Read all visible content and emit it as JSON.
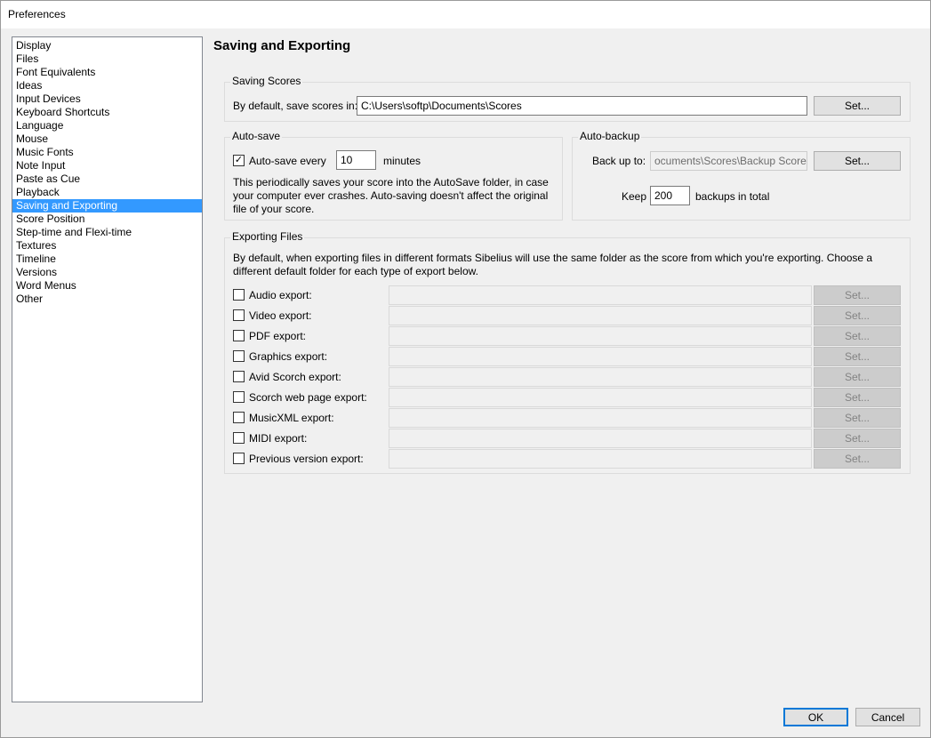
{
  "window": {
    "title": "Preferences"
  },
  "sidebar": {
    "items": [
      {
        "label": "Display"
      },
      {
        "label": "Files"
      },
      {
        "label": "Font Equivalents"
      },
      {
        "label": "Ideas"
      },
      {
        "label": "Input Devices"
      },
      {
        "label": "Keyboard Shortcuts"
      },
      {
        "label": "Language"
      },
      {
        "label": "Mouse"
      },
      {
        "label": "Music Fonts"
      },
      {
        "label": "Note Input"
      },
      {
        "label": "Paste as Cue"
      },
      {
        "label": "Playback"
      },
      {
        "label": "Saving and Exporting"
      },
      {
        "label": "Score Position"
      },
      {
        "label": "Step-time and Flexi-time"
      },
      {
        "label": "Textures"
      },
      {
        "label": "Timeline"
      },
      {
        "label": "Versions"
      },
      {
        "label": "Word Menus"
      },
      {
        "label": "Other"
      }
    ],
    "selected": "Saving and Exporting"
  },
  "page": {
    "title": "Saving and Exporting"
  },
  "saving_scores": {
    "group_label": "Saving Scores",
    "label": "By default, save scores in:",
    "path": "C:\\Users\\softp\\Documents\\Scores",
    "set_label": "Set..."
  },
  "auto_save": {
    "group_label": "Auto-save",
    "checkbox_label": "Auto-save every",
    "checked": true,
    "minutes_value": "10",
    "minutes_label": "minutes",
    "description_lines": [
      "This periodically saves your score into the AutoSave folder, in case",
      "your computer ever crashes. Auto-saving doesn't affect the original",
      "file of your score."
    ]
  },
  "auto_backup": {
    "group_label": "Auto-backup",
    "backup_label": "Back up to:",
    "backup_path": "ocuments\\Scores\\Backup Scores",
    "set_label": "Set...",
    "keep_label": "Keep",
    "keep_value": "200",
    "keep_suffix": "backups in total"
  },
  "exporting": {
    "group_label": "Exporting Files",
    "description_lines": [
      "By default, when exporting files in different formats Sibelius will use the same folder as the score from which you're exporting. Choose a",
      "different default folder for each type of export below."
    ],
    "rows": [
      {
        "label": "Audio export:",
        "checked": false,
        "path": "",
        "set_label": "Set..."
      },
      {
        "label": "Video export:",
        "checked": false,
        "path": "",
        "set_label": "Set..."
      },
      {
        "label": "PDF export:",
        "checked": false,
        "path": "",
        "set_label": "Set..."
      },
      {
        "label": "Graphics export:",
        "checked": false,
        "path": "",
        "set_label": "Set..."
      },
      {
        "label": "Avid Scorch export:",
        "checked": false,
        "path": "",
        "set_label": "Set..."
      },
      {
        "label": "Scorch web page export:",
        "checked": false,
        "path": "",
        "set_label": "Set..."
      },
      {
        "label": "MusicXML export:",
        "checked": false,
        "path": "",
        "set_label": "Set..."
      },
      {
        "label": "MIDI export:",
        "checked": false,
        "path": "",
        "set_label": "Set..."
      },
      {
        "label": "Previous version export:",
        "checked": false,
        "path": "",
        "set_label": "Set..."
      }
    ]
  },
  "footer": {
    "ok_label": "OK",
    "cancel_label": "Cancel"
  }
}
